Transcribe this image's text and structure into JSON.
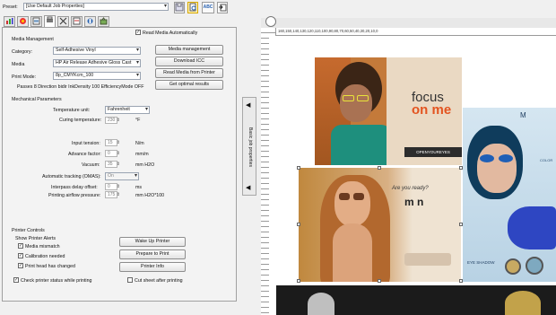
{
  "preset": {
    "label": "Preset:",
    "value": "[Use Default Job Properties]"
  },
  "toolbar": {
    "abc_label": "ABC"
  },
  "read_media_auto": {
    "label": "Read Media Automatically",
    "checked": true
  },
  "media_management": {
    "title": "Media Management",
    "category_label": "Category:",
    "category_value": "Self-Adhesive Vinyl",
    "media_label": "Media",
    "media_value": "HP Air Release Adhesive Gloss Cast",
    "print_mode_label": "Print Mode:",
    "print_mode_value": "8p_CMYKcm_100",
    "passes_text": "Passes 8 Direction bidir InkDensity 100 EfficiencyMode OFF",
    "buttons": [
      "Media management",
      "Download ICC",
      "Read Media from Printer",
      "Get optimal results"
    ]
  },
  "mechanical": {
    "title": "Mechanical Parameters",
    "temp_unit_label": "Temperature unit:",
    "temp_unit_value": "Fahrenheit",
    "curing_label": "Curing temperature:",
    "curing_value": "230",
    "curing_unit": "°F",
    "input_tension_label": "Input tension:",
    "input_tension_value": "15",
    "input_tension_unit": "N/m",
    "advance_label": "Advance factor:",
    "advance_value": "0",
    "advance_unit": "mm/m",
    "vacuum_label": "Vacuum:",
    "vacuum_value": "35",
    "vacuum_unit": "mm H2O",
    "omas_label": "Automatic tracking (OMAS):",
    "omas_value": "On",
    "interpass_label": "Interpass delay offset:",
    "interpass_value": "0",
    "interpass_unit": "ms",
    "airflow_label": "Printing airflow pressure:",
    "airflow_value": "175",
    "airflow_unit": "mm H2O*100"
  },
  "printer_controls": {
    "title": "Printer Controls",
    "show_alerts": "Show Printer Alerts",
    "alerts": [
      "Media mismatch",
      "Calibration needed",
      "Print head has changed"
    ],
    "buttons": [
      "Wake Up Printer",
      "Prepare to Print",
      "Printer Info"
    ],
    "check_status": "Check printer status while printing",
    "cut_sheet": "Cut sheet after printing"
  },
  "side_tab": {
    "label": "Basic job properties"
  },
  "ruler": {
    "text": "160,150,140,130,120,110,100,90,80,70,60,50,40,30,20,10,0"
  },
  "canvas": {
    "ad1": {
      "line1": "focus",
      "line2": "on me",
      "tagline": "OPENYOUREYES"
    },
    "ad2": {
      "text": "Are you ready?",
      "brand": "m n"
    },
    "ad3": {
      "top": "M",
      "side": "COLOR",
      "bottom": "EYE SHADOW"
    }
  },
  "colors": {
    "accent": "#2a63b0",
    "panel": "#f0f0f0"
  }
}
